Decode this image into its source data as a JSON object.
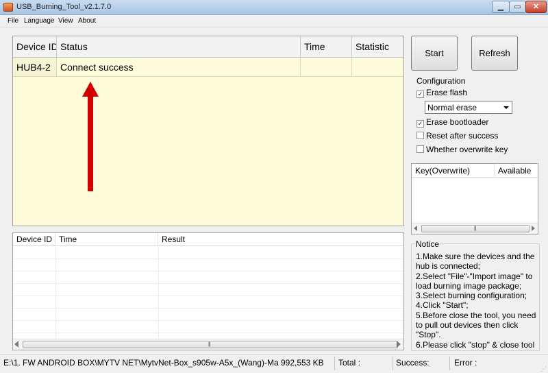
{
  "window": {
    "title": "USB_Burning_Tool_v2.1.7.0",
    "controls": [
      "minimize",
      "maximize",
      "close"
    ]
  },
  "menu": {
    "items": [
      "File",
      "Language",
      "View",
      "About"
    ]
  },
  "device_table": {
    "headers": [
      "Device ID",
      "Status",
      "Time",
      "Statistic"
    ],
    "rows": [
      {
        "device_id": "HUB4-2",
        "status": "Connect success",
        "time": "",
        "statistic": ""
      }
    ]
  },
  "result_table": {
    "headers": [
      "Device ID",
      "Time",
      "Result"
    ],
    "rows": []
  },
  "buttons": {
    "start": "Start",
    "refresh": "Refresh"
  },
  "configuration": {
    "title": "Configuration",
    "erase_flash": {
      "label": "Erase flash",
      "checked": true
    },
    "erase_mode": {
      "selected": "Normal erase"
    },
    "erase_bootloader": {
      "label": "Erase bootloader",
      "checked": true
    },
    "reset_after_success": {
      "label": "Reset after success",
      "checked": false
    },
    "overwrite_key": {
      "label": "Whether overwrite key",
      "checked": false
    }
  },
  "key_table": {
    "headers": [
      "Key(Overwrite)",
      "Available"
    ]
  },
  "notice": {
    "title": "Notice",
    "lines": [
      "1.Make sure the devices and the",
      "hub is connected;",
      "2.Select \"File\"-\"Import image\" to",
      "load burning image package;",
      "3.Select burning configuration;",
      "4.Click \"Start\";",
      "5.Before close the tool, you need",
      "to pull out devices then click",
      "\"Stop\".",
      "6.Please click \"stop\" & close tool"
    ]
  },
  "status_bar": {
    "image_path": "E:\\1. FW ANDROID BOX\\MYTV NET\\MytvNet-Box_s905w-A5x_(Wang)-Ma 992,553 KB",
    "total": "Total :",
    "success": "Success:",
    "error": "Error :"
  },
  "colors": {
    "grid_background": "#fdfbd9",
    "arrow": "#d40000"
  }
}
